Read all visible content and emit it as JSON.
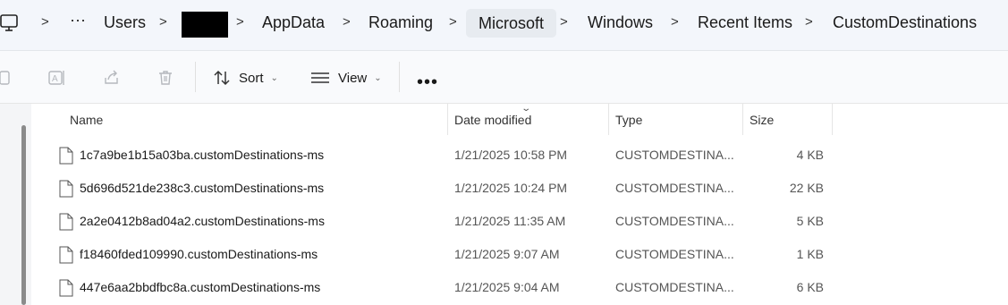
{
  "breadcrumb": {
    "root_icon": "computer-icon",
    "overflow": "···",
    "separator": ">",
    "items": [
      "Users",
      "",
      "AppData",
      "Roaming",
      "Microsoft",
      "Windows",
      "Recent Items",
      "CustomDestinations"
    ]
  },
  "toolbar": {
    "icons": [
      "copy-icon",
      "rename-icon",
      "share-icon",
      "delete-icon"
    ],
    "sort_label": "Sort",
    "view_label": "View",
    "more_label": "•••"
  },
  "columns": {
    "name": "Name",
    "date": "Date modified",
    "type": "Type",
    "size": "Size"
  },
  "files": [
    {
      "name": "1c7a9be1b15a03ba.customDestinations-ms",
      "date": "1/21/2025 10:58 PM",
      "type": "CUSTOMDESTINA...",
      "size": "4 KB"
    },
    {
      "name": "5d696d521de238c3.customDestinations-ms",
      "date": "1/21/2025 10:24 PM",
      "type": "CUSTOMDESTINA...",
      "size": "22 KB"
    },
    {
      "name": "2a2e0412b8ad04a2.customDestinations-ms",
      "date": "1/21/2025 11:35 AM",
      "type": "CUSTOMDESTINA...",
      "size": "5 KB"
    },
    {
      "name": "f18460fded109990.customDestinations-ms",
      "date": "1/21/2025 9:07 AM",
      "type": "CUSTOMDESTINA...",
      "size": "1 KB"
    },
    {
      "name": "447e6aa2bbdfbc8a.customDestinations-ms",
      "date": "1/21/2025 9:04 AM",
      "type": "CUSTOMDESTINA...",
      "size": "6 KB"
    }
  ],
  "colors": {
    "address_bg": "#f3f6fb",
    "toolbar_bg": "#f9fafc",
    "text": "#1a1a1a",
    "muted": "#555555"
  }
}
